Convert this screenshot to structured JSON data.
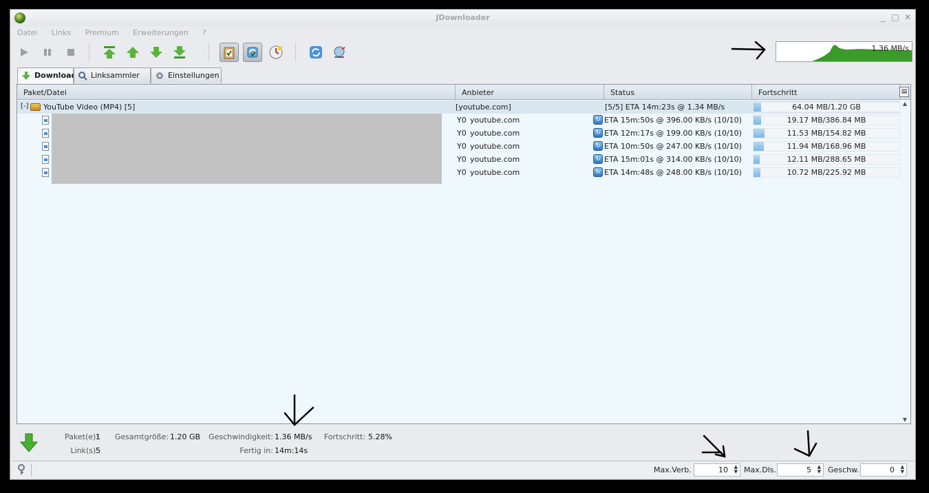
{
  "window": {
    "title": "JDownloader"
  },
  "menu": [
    "Datei",
    "Links",
    "Premium",
    "Erweiterungen",
    "?"
  ],
  "toolbar": {
    "buttons": [
      "play-icon",
      "pause-icon",
      "stop-icon",
      "move-top-icon",
      "move-up-icon",
      "move-down-icon",
      "move-bottom-icon",
      "clipboard-icon",
      "reconnect-icon",
      "clock-icon",
      "refresh-icon",
      "update-icon"
    ]
  },
  "speed_meter": {
    "label": "1.36 MB/s",
    "color": "#3a9a2a"
  },
  "tabs": [
    {
      "label": "Download",
      "active": true
    },
    {
      "label": "Linksammler",
      "active": false
    },
    {
      "label": "Einstellungen",
      "active": false
    }
  ],
  "table": {
    "columns": [
      "Paket/Datei",
      "Anbieter",
      "Status",
      "Fortschritt"
    ],
    "package": {
      "expander": "[-]",
      "name": "YouTube Video (MP4) [5]",
      "host": "[youtube.com]",
      "status": "[5/5] ETA 14m:23s @ 1.34 MB/s",
      "progress_text": "64.04 MB/1.20 GB",
      "progress": 0.0528
    },
    "files": [
      {
        "host_prefix": "Y0",
        "host": "youtube.com",
        "status": "ETA 15m:50s @ 396.00 KB/s (10/10)",
        "progress_text": "19.17 MB/386.84 MB",
        "progress": 0.0496
      },
      {
        "host_prefix": "Y0",
        "host": "youtube.com",
        "status": "ETA 12m:17s @ 199.00 KB/s (10/10)",
        "progress_text": "11.53 MB/154.82 MB",
        "progress": 0.0745
      },
      {
        "host_prefix": "Y0",
        "host": "youtube.com",
        "status": "ETA 10m:50s @ 247.00 KB/s (10/10)",
        "progress_text": "11.94 MB/168.96 MB",
        "progress": 0.0707
      },
      {
        "host_prefix": "Y0",
        "host": "youtube.com",
        "status": "ETA 15m:01s @ 314.00 KB/s (10/10)",
        "progress_text": "12.11 MB/288.65 MB",
        "progress": 0.042
      },
      {
        "host_prefix": "Y0",
        "host": "youtube.com",
        "status": "ETA 14m:48s @ 248.00 KB/s (10/10)",
        "progress_text": "10.72 MB/225.92 MB",
        "progress": 0.0474
      }
    ]
  },
  "summary": {
    "packages_label": "Paket(e):",
    "packages_value": "1",
    "total_size_label": "Gesamtgröße:",
    "total_size_value": "1.20 GB",
    "speed_label": "Geschwindigkeit:",
    "speed_value": "1.36 MB/s",
    "progress_label": "Fortschritt:",
    "progress_value": "5.28%",
    "links_label": "Link(s):",
    "links_value": "5",
    "finished_label": "Fertig in:",
    "finished_value": "14m:14s"
  },
  "statusbar": {
    "max_connections_label": "Max.Verb.",
    "max_connections_value": "10",
    "max_downloads_label": "Max.Dls.",
    "max_downloads_value": "5",
    "speed_limit_label": "Geschw.",
    "speed_limit_value": "0"
  }
}
